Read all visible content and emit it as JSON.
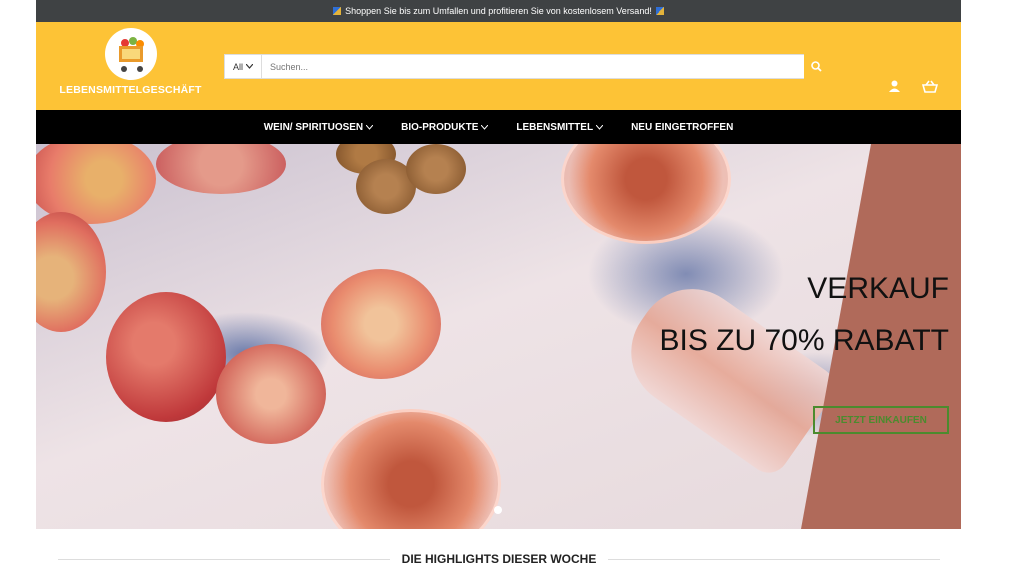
{
  "topbar": {
    "text": "Shoppen Sie bis zum Umfallen und profitieren Sie von kostenlosem Versand!"
  },
  "header": {
    "logo_text": "LEBENSMITTELGESCHÄFT",
    "search": {
      "category": "All",
      "placeholder": "Suchen..."
    }
  },
  "nav": {
    "items": [
      {
        "label": "WEIN/ SPIRITUOSEN"
      },
      {
        "label": "BIO-PRODUKTE"
      },
      {
        "label": "LEBENSMITTEL"
      },
      {
        "label": "NEU EINGETROFFEN"
      }
    ]
  },
  "hero": {
    "title": "VERKAUF",
    "subtitle": "BIS ZU 70% RABATT",
    "button": "JETZT EINKAUFEN"
  },
  "section": {
    "title": "DIE HIGHLIGHTS DIESER WOCHE"
  },
  "colors": {
    "header": "#fdc336",
    "nav": "#000000",
    "topbar": "#3f4244",
    "panel": "#b06a5a",
    "button": "#4b8b2e"
  }
}
